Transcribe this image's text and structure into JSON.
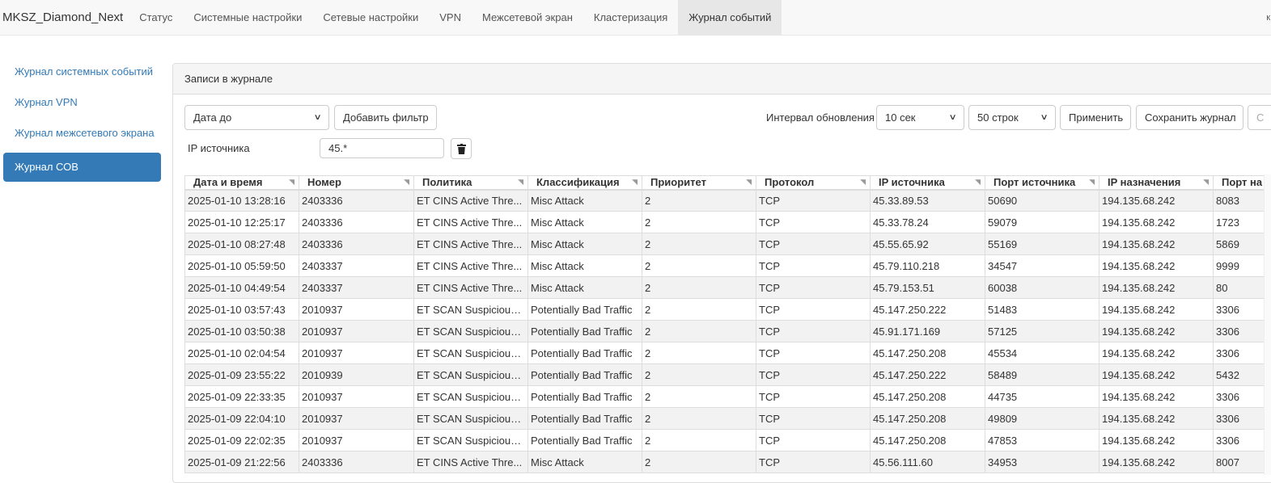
{
  "navbar": {
    "brand": "MKSZ_Diamond_Next",
    "items": [
      {
        "label": "Статус"
      },
      {
        "label": "Системные настройки"
      },
      {
        "label": "Сетевые настройки"
      },
      {
        "label": "VPN"
      },
      {
        "label": "Межсетевой экран"
      },
      {
        "label": "Кластеризация"
      },
      {
        "label": "Журнал событий"
      }
    ],
    "active_index": 6,
    "right_fragment": "к"
  },
  "sidebar": {
    "items": [
      {
        "label": "Журнал системных событий"
      },
      {
        "label": "Журнал VPN"
      },
      {
        "label": "Журнал межсетевого экрана"
      },
      {
        "label": "Журнал СОВ"
      }
    ],
    "active_index": 3
  },
  "panel": {
    "title": "Записи в журнале",
    "filter_select": "Дата до",
    "add_filter_button": "Добавить фильтр",
    "refresh_interval_label": "Интервал обновления",
    "refresh_interval_value": "10 сек",
    "rows_select_value": "50 строк",
    "apply_button": "Применить",
    "save_log_button": "Сохранить журнал",
    "clear_button_fragment": "С",
    "ip_filter_label": "IP источника",
    "ip_filter_value": "45.*"
  },
  "table": {
    "columns": [
      "Дата и время",
      "Номер",
      "Политика",
      "Классификация",
      "Приоритет",
      "Протокол",
      "IP источника",
      "Порт источника",
      "IP назначения",
      "Порт на"
    ],
    "rows": [
      [
        "2025-01-10 13:28:16",
        "2403336",
        "ET CINS Active Thre...",
        "Misc Attack",
        "2",
        "TCP",
        "45.33.89.53",
        "50690",
        "194.135.68.242",
        "8083"
      ],
      [
        "2025-01-10 12:25:17",
        "2403336",
        "ET CINS Active Thre...",
        "Misc Attack",
        "2",
        "TCP",
        "45.33.78.24",
        "59079",
        "194.135.68.242",
        "1723"
      ],
      [
        "2025-01-10 08:27:48",
        "2403336",
        "ET CINS Active Thre...",
        "Misc Attack",
        "2",
        "TCP",
        "45.55.65.92",
        "55169",
        "194.135.68.242",
        "5869"
      ],
      [
        "2025-01-10 05:59:50",
        "2403337",
        "ET CINS Active Thre...",
        "Misc Attack",
        "2",
        "TCP",
        "45.79.110.218",
        "34547",
        "194.135.68.242",
        "9999"
      ],
      [
        "2025-01-10 04:49:54",
        "2403337",
        "ET CINS Active Thre...",
        "Misc Attack",
        "2",
        "TCP",
        "45.79.153.51",
        "60038",
        "194.135.68.242",
        "80"
      ],
      [
        "2025-01-10 03:57:43",
        "2010937",
        "ET SCAN Suspicious ...",
        "Potentially Bad Traffic",
        "2",
        "TCP",
        "45.147.250.222",
        "51483",
        "194.135.68.242",
        "3306"
      ],
      [
        "2025-01-10 03:50:38",
        "2010937",
        "ET SCAN Suspicious ...",
        "Potentially Bad Traffic",
        "2",
        "TCP",
        "45.91.171.169",
        "57125",
        "194.135.68.242",
        "3306"
      ],
      [
        "2025-01-10 02:04:54",
        "2010937",
        "ET SCAN Suspicious ...",
        "Potentially Bad Traffic",
        "2",
        "TCP",
        "45.147.250.208",
        "45534",
        "194.135.68.242",
        "3306"
      ],
      [
        "2025-01-09 23:55:22",
        "2010939",
        "ET SCAN Suspicious ...",
        "Potentially Bad Traffic",
        "2",
        "TCP",
        "45.147.250.222",
        "58489",
        "194.135.68.242",
        "5432"
      ],
      [
        "2025-01-09 22:33:35",
        "2010937",
        "ET SCAN Suspicious ...",
        "Potentially Bad Traffic",
        "2",
        "TCP",
        "45.147.250.208",
        "44735",
        "194.135.68.242",
        "3306"
      ],
      [
        "2025-01-09 22:04:10",
        "2010937",
        "ET SCAN Suspicious ...",
        "Potentially Bad Traffic",
        "2",
        "TCP",
        "45.147.250.208",
        "49809",
        "194.135.68.242",
        "3306"
      ],
      [
        "2025-01-09 22:02:35",
        "2010937",
        "ET SCAN Suspicious ...",
        "Potentially Bad Traffic",
        "2",
        "TCP",
        "45.147.250.208",
        "47853",
        "194.135.68.242",
        "3306"
      ],
      [
        "2025-01-09 21:22:56",
        "2403336",
        "ET CINS Active Thre...",
        "Misc Attack",
        "2",
        "TCP",
        "45.56.111.60",
        "34953",
        "194.135.68.242",
        "8007"
      ]
    ]
  },
  "icons": {
    "trash": "trash-icon",
    "dropdown": "chevron-down-icon",
    "sort": "sort-icon"
  },
  "colors": {
    "accent": "#337ab7",
    "navbar_bg": "#f8f8f8",
    "active_tab_bg": "#e7e7e7",
    "stripe": "#f2f2f2"
  }
}
